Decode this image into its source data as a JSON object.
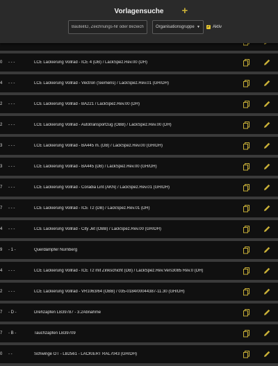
{
  "header": {
    "title": "Vorlagensuche",
    "add_icon": "plus-icon",
    "accent_color": "#c9b037"
  },
  "filters": {
    "search_placeholder": "BauteilID, Zeichnungs-Nr oder Bezeichnung",
    "org_select_label": "Organisationsgruppe",
    "active_label": "Aktiv",
    "active_checked": true
  },
  "rows": [
    {
      "num": "",
      "sep": "",
      "label": "..."
    },
    {
      "num": "0",
      "sep": "- - -",
      "label": "LCE Lackierung Vollrad - ICE 4 (DB) / LackSpez.Rev.00 (DH)"
    },
    {
      "num": "4",
      "sep": "- - -",
      "label": "LCE Lackierung Vollrad - Vectron (Siemens) / LackSpez.Rev.01 (GH/DH)"
    },
    {
      "num": "2",
      "sep": "- - -",
      "label": "LCE Lackierung Vollrad - BA221 / LackSpez.Rev.00 (DH)"
    },
    {
      "num": "2",
      "sep": "- - -",
      "label": "LCE Lackierung Vollrad - Autotransportzug (ÖBB) / LackSpez.Rev.00 (DH)"
    },
    {
      "num": "3",
      "sep": "- - -",
      "label": "LCE Lackierung Vollrad - BA445 m. (DB) / LackSpez.Rev.00 (GH/DH)"
    },
    {
      "num": "3",
      "sep": "- - -",
      "label": "LCE Lackierung Vollrad - BA445 (DB) / LackSpez.Rev.00 (GH/DH)"
    },
    {
      "num": "7",
      "sep": "- - -",
      "label": "LCE Lackierung Vollrad - Coradia Lint (AKN) / LackSpez.Rev.01 (GH/DH)"
    },
    {
      "num": "7",
      "sep": "- - -",
      "label": "LCE Lackierung Vollrad - ICE T2 (DB) / LackSpez.Rev.01 (DH)"
    },
    {
      "num": "4",
      "sep": "- - -",
      "label": "LCE Lackierung Vollrad - City Jet (ÖBB) / LackSpez.Rev.00 (GH/DH)"
    },
    {
      "num": "9",
      "sep": "- 1 -",
      "label": "Querdämpfer Nürnberg"
    },
    {
      "num": "4",
      "sep": "- - -",
      "label": "LCE Lackierung Vollrad - ICE T2 mit Zinkschicht (DB) / LackSpez.Rev.Vers3085 Rev.0 (DH)"
    },
    {
      "num": "2",
      "sep": "- - -",
      "label": "LCE Lackierung Vollrad - VR1063/64 (ÖBB) / 035-0184/00044387-11.30 (GH/DH)"
    },
    {
      "num": "7",
      "sep": "- D -",
      "label": "Drehzapfen LB39787 - 3.2Abnahme"
    },
    {
      "num": "7",
      "sep": "- B -",
      "label": "Tauchzapfen LB39709"
    },
    {
      "num": "0",
      "sep": "- -",
      "label": "Schwinge OT - LB2561 - LACKIERT RAL7043 (GH/DH)"
    }
  ],
  "row_icons": {
    "copy": "copy-icon",
    "edit": "pencil-icon"
  }
}
